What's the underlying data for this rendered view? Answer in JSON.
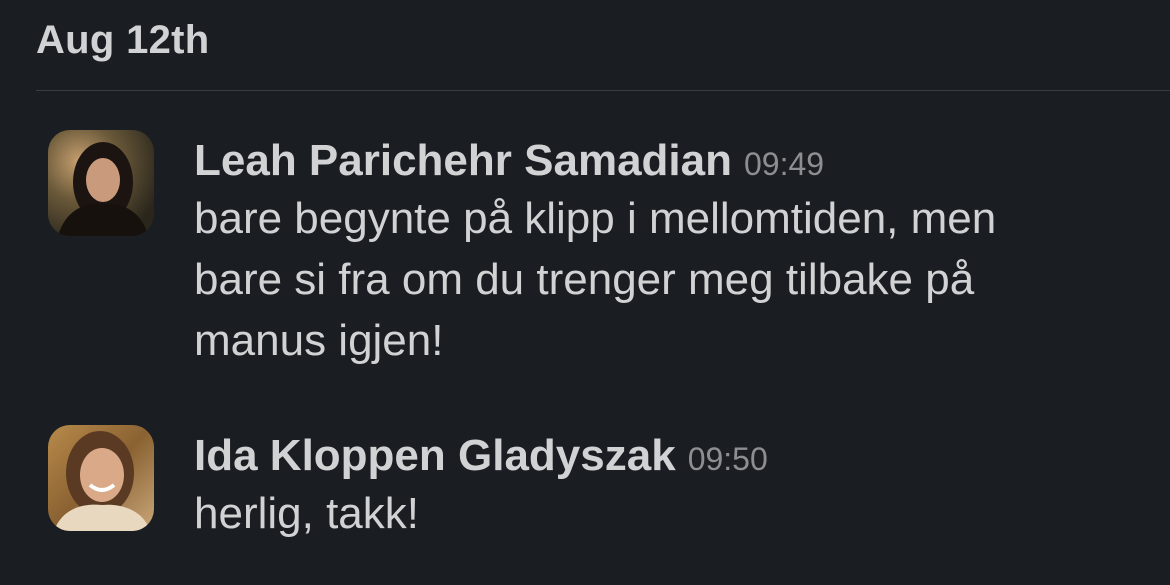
{
  "day_group": {
    "date_label": "Aug 12th"
  },
  "messages": [
    {
      "author": "Leah Parichehr Samadian",
      "time": "09:49",
      "lines": [
        "bare begynte på klipp i mellomtiden, men",
        "bare si fra om du trenger meg tilbake på",
        "manus igjen!"
      ],
      "avatar_icon": "profile-photo"
    },
    {
      "author": "Ida Kloppen Gladyszak",
      "time": "09:50",
      "lines": [
        "herlig, takk!"
      ],
      "avatar_icon": "profile-photo"
    }
  ]
}
